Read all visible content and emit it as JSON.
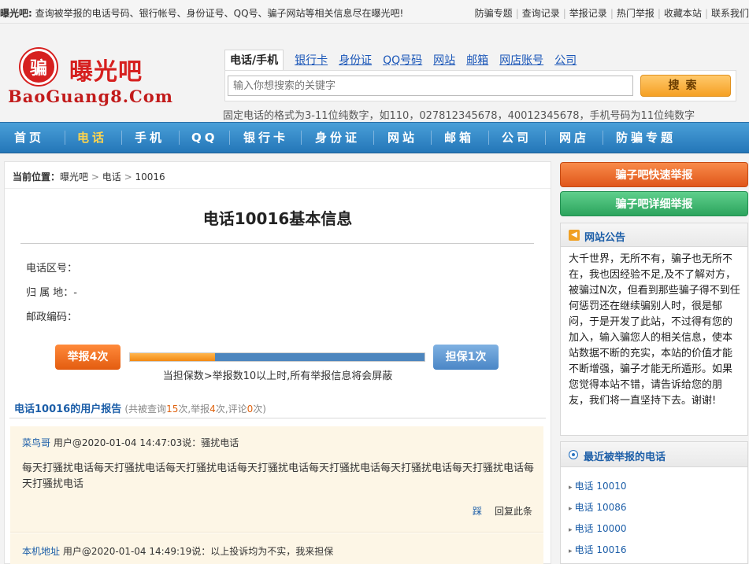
{
  "topbar": {
    "site": "曝光吧:",
    "tip": "查询被举报的电话号码、银行帐号、身份证号、QQ号、骗子网站等相关信息尽在曝光吧!",
    "links": [
      "防骗专题",
      "查询记录",
      "举报记录",
      "热门举报",
      "收藏本站",
      "联系我们"
    ]
  },
  "logo": {
    "badge": "骗",
    "cn": "曝光吧",
    "en": "BaoGuang8.Com"
  },
  "search": {
    "tabs": [
      "电话/手机",
      "银行卡",
      "身份证",
      "QQ号码",
      "网站",
      "邮箱",
      "网店账号",
      "公司"
    ],
    "placeholder": "输入你想搜索的关键字",
    "button": "搜索",
    "hint": "固定电话的格式为3-11位纯数字，如110，027812345678，40012345678，手机号码为11位纯数字"
  },
  "nav": [
    "首页",
    "电话",
    "手机",
    "QQ",
    "银行卡",
    "身份证",
    "网站",
    "邮箱",
    "公司",
    "网店",
    "防骗专题"
  ],
  "breadcrumb": {
    "label": "当前位置：",
    "home": "曝光吧",
    "sep1": ">",
    "cat": "电话",
    "sep2": ">",
    "current": "10016"
  },
  "detail": {
    "title": "电话10016基本信息",
    "area_code": "电话区号：",
    "location": "归 属 地：-",
    "zipcode": "邮政编码："
  },
  "stats": {
    "report_btn": "举报4次",
    "guarantee_btn": "担保1次",
    "report_ratio": 0.29,
    "note": "当担保数>举报数10以上时,所有举报信息将会屏蔽"
  },
  "reports": {
    "title": "电话10016的用户报告",
    "summary_pre": "(共被查询",
    "queries": "15",
    "summary_mid1": "次,举报",
    "reports": "4",
    "summary_mid2": "次,评论",
    "comments": "0",
    "summary_end": "次)",
    "items": [
      {
        "name": "菜鸟哥",
        "meta": " 用户@2020-01-04 14:47:03说：骚扰电话",
        "body": "每天打骚扰电话每天打骚扰电话每天打骚扰电话每天打骚扰电话每天打骚扰电话每天打骚扰电话每天打骚扰电话每天打骚扰电话",
        "step": "踩",
        "reply": "回复此条"
      },
      {
        "name": "本机地址",
        "meta": " 用户@2020-01-04 14:49:19说：以上投诉均为不实，我来担保"
      }
    ]
  },
  "side": {
    "quick_report": "骗子吧快速举报",
    "detail_report": "骗子吧详细举报",
    "notice_title": "网站公告",
    "notice_body": "大千世界，无所不有，骗子也无所不在，我也因经验不足,及不了解对方，被骗过N次，但看到那些骗子得不到任何惩罚还在继续骗别人时，很是郁闷，于是开发了此站，不过得有您的加入，输入骗您人的相关信息，使本站数据不断的充实，本站的价值才能不断增强，骗子才能无所遁形。如果您觉得本站不错，请告诉给您的朋友，我们将一直坚持下去。谢谢!",
    "recent_title": "最近被举报的电话",
    "recent": [
      "电话 10010",
      "电话 10086",
      "电话 10000",
      "电话 10016"
    ]
  },
  "colors": {
    "nav_blue": "#2476b8",
    "nav_active": "#ffd54d",
    "report_orange": "#e35c10",
    "guarantee_blue": "#4a86c6",
    "link_blue": "#1c5ea8"
  }
}
